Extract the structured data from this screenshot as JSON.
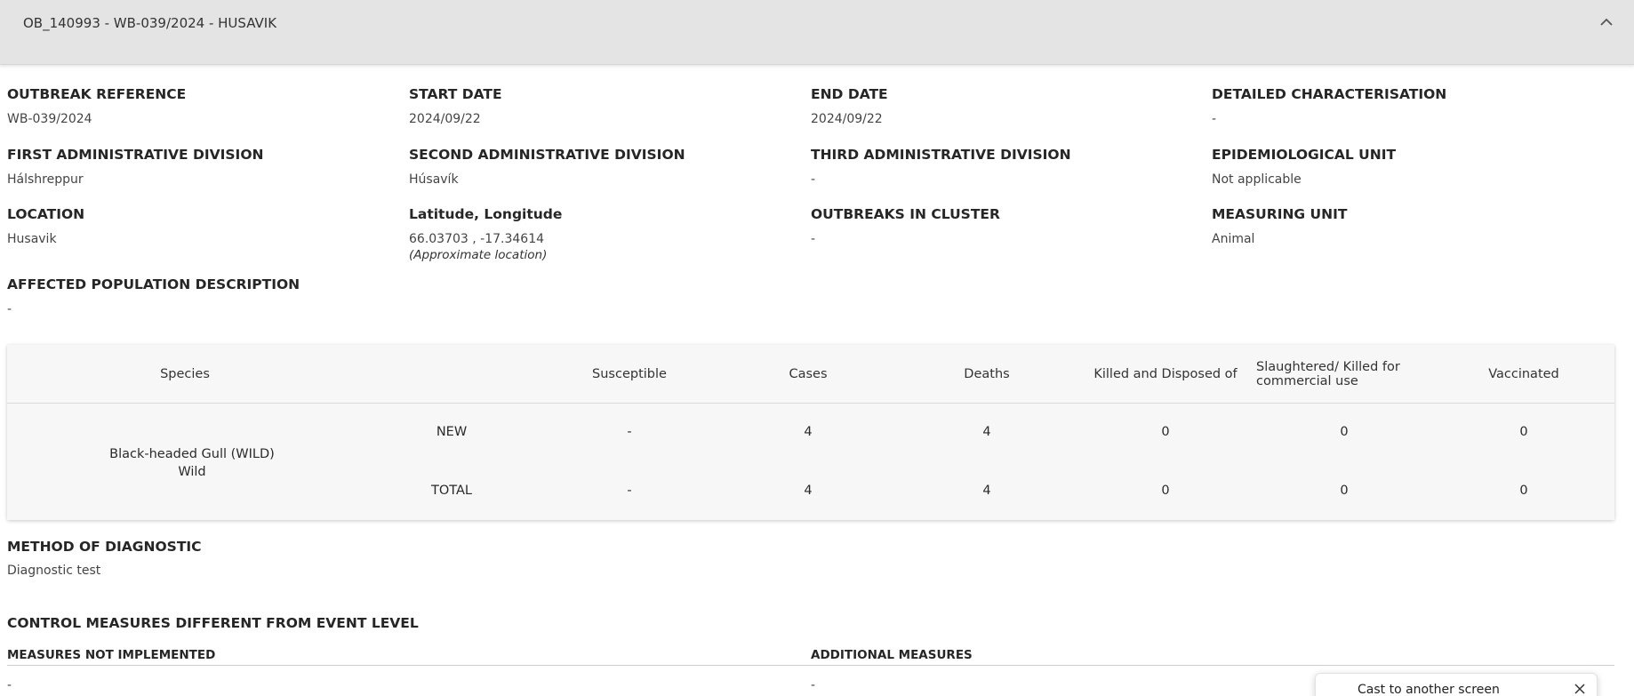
{
  "header": {
    "title": "OB_140993 - WB-039/2024 - HUSAVIK",
    "toggle_icon": "chevron-up-icon"
  },
  "fields": {
    "outbreak_reference": {
      "label": "OUTBREAK REFERENCE",
      "value": "WB-039/2024"
    },
    "start_date": {
      "label": "START DATE",
      "value": "2024/09/22"
    },
    "end_date": {
      "label": "END DATE",
      "value": "2024/09/22"
    },
    "detailed_characterisation": {
      "label": "DETAILED CHARACTERISATION",
      "value": "-"
    },
    "first_admin_division": {
      "label": "FIRST ADMINISTRATIVE DIVISION",
      "value": "Hálshreppur"
    },
    "second_admin_division": {
      "label": "SECOND ADMINISTRATIVE DIVISION",
      "value": "Húsavík"
    },
    "third_admin_division": {
      "label": "THIRD ADMINISTRATIVE DIVISION",
      "value": "-"
    },
    "epidemiological_unit": {
      "label": "EPIDEMIOLOGICAL UNIT",
      "value": "Not applicable"
    },
    "location": {
      "label": "LOCATION",
      "value": "Husavik"
    },
    "lat_long": {
      "label": "Latitude, Longitude",
      "value": "66.03703 , -17.34614",
      "note": "(Approximate location)"
    },
    "outbreaks_in_cluster": {
      "label": "OUTBREAKS IN CLUSTER",
      "value": "-"
    },
    "measuring_unit": {
      "label": "MEASURING UNIT",
      "value": "Animal"
    },
    "affected_population": {
      "label": "AFFECTED POPULATION DESCRIPTION",
      "value": "-"
    }
  },
  "table": {
    "headers": {
      "species": "Species",
      "susceptible": "Susceptible",
      "cases": "Cases",
      "deaths": "Deaths",
      "killed": "Killed and Disposed of",
      "slaughtered_line1": "Slaughtered/ Killed for",
      "slaughtered_line2": "commercial use",
      "vaccinated": "Vaccinated"
    },
    "species_name": "Black-headed Gull (WILD)",
    "species_type": "Wild",
    "rows": [
      {
        "type": "NEW",
        "susceptible": "-",
        "cases": "4",
        "deaths": "4",
        "killed": "0",
        "slaughtered": "0",
        "vaccinated": "0"
      },
      {
        "type": "TOTAL",
        "susceptible": "-",
        "cases": "4",
        "deaths": "4",
        "killed": "0",
        "slaughtered": "0",
        "vaccinated": "0"
      }
    ]
  },
  "diagnostic": {
    "label": "METHOD OF DIAGNOSTIC",
    "value": "Diagnostic test"
  },
  "control_measures": {
    "title": "CONTROL MEASURES DIFFERENT FROM EVENT LEVEL",
    "not_implemented_label": "MEASURES NOT IMPLEMENTED",
    "not_implemented_value": "-",
    "additional_label": "ADDITIONAL MEASURES",
    "additional_value": "-"
  },
  "toast": {
    "text": "Cast to another screen",
    "close_icon": "close-icon"
  }
}
